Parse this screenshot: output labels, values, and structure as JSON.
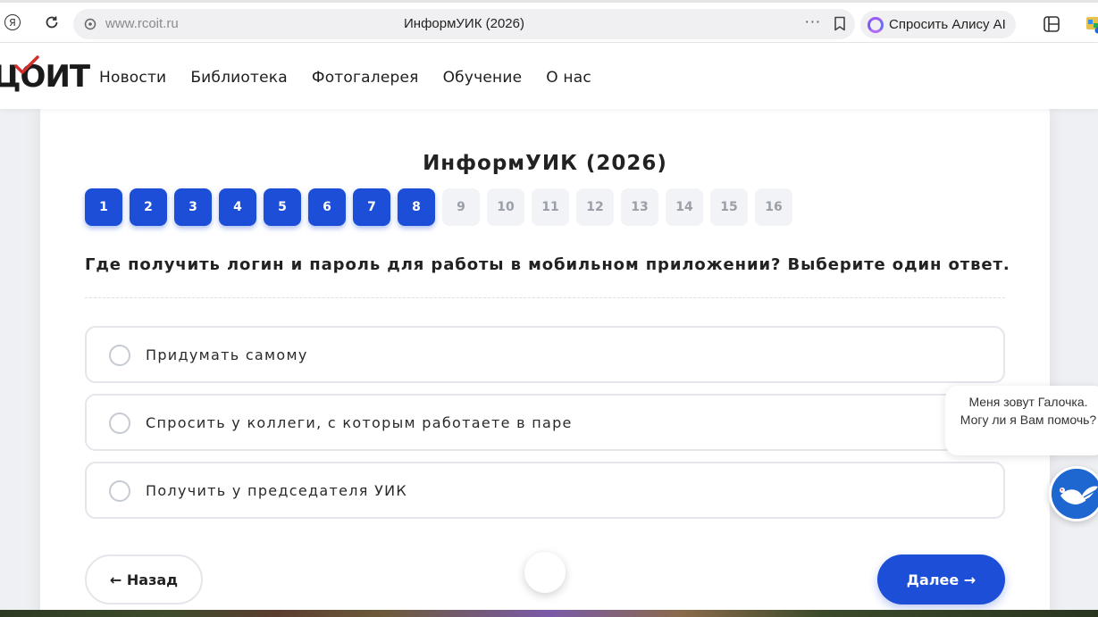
{
  "browser": {
    "url": "www.rcoit.ru",
    "tab_title": "ИнформУИК (2026)",
    "alice_label": "Спросить Алису AI",
    "menu_dots": "···"
  },
  "site": {
    "logo_text": "ЦОИТ",
    "nav": [
      "Новости",
      "Библиотека",
      "Фотогалерея",
      "Обучение",
      "О нас"
    ]
  },
  "quiz": {
    "title": "ИнформУИК (2026)",
    "steps": [
      "1",
      "2",
      "3",
      "4",
      "5",
      "6",
      "7",
      "8",
      "9",
      "10",
      "11",
      "12",
      "13",
      "14",
      "15",
      "16"
    ],
    "completed_steps": 8,
    "question": "Где получить логин и пароль для работы в мобильном приложении? Выберите один ответ.",
    "options": [
      "Придумать самому",
      "Спросить у коллеги, с которым работаете в паре",
      "Получить у председателя УИК"
    ],
    "back_label": "← Назад",
    "next_label": "Далее →"
  },
  "chat": {
    "message": "Меня зовут Галочка. Могу ли я Вам помочь?"
  },
  "colors": {
    "accent": "#1d4ed8",
    "logo_check": "#d32f2f"
  }
}
